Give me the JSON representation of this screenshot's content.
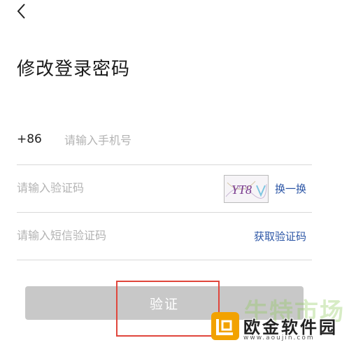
{
  "header": {
    "back_icon": "chevron-left-icon"
  },
  "page_title": "修改登录密码",
  "phone": {
    "prefix": "+86",
    "placeholder": "请输入手机号"
  },
  "captcha": {
    "placeholder": "请输入验证码",
    "image_text": "YT8",
    "refresh_label": "换一换"
  },
  "sms": {
    "placeholder": "请输入短信验证码",
    "get_code_label": "获取验证码"
  },
  "submit_label": "验证",
  "watermark": {
    "top_text": "牛特市场",
    "name": "欧金软件园",
    "url": "www.aoujin.com"
  },
  "colors": {
    "link": "#2c56a6",
    "button_disabled": "#c8c8c8",
    "highlight": "#e0463c",
    "divider": "#d9d9d9"
  }
}
